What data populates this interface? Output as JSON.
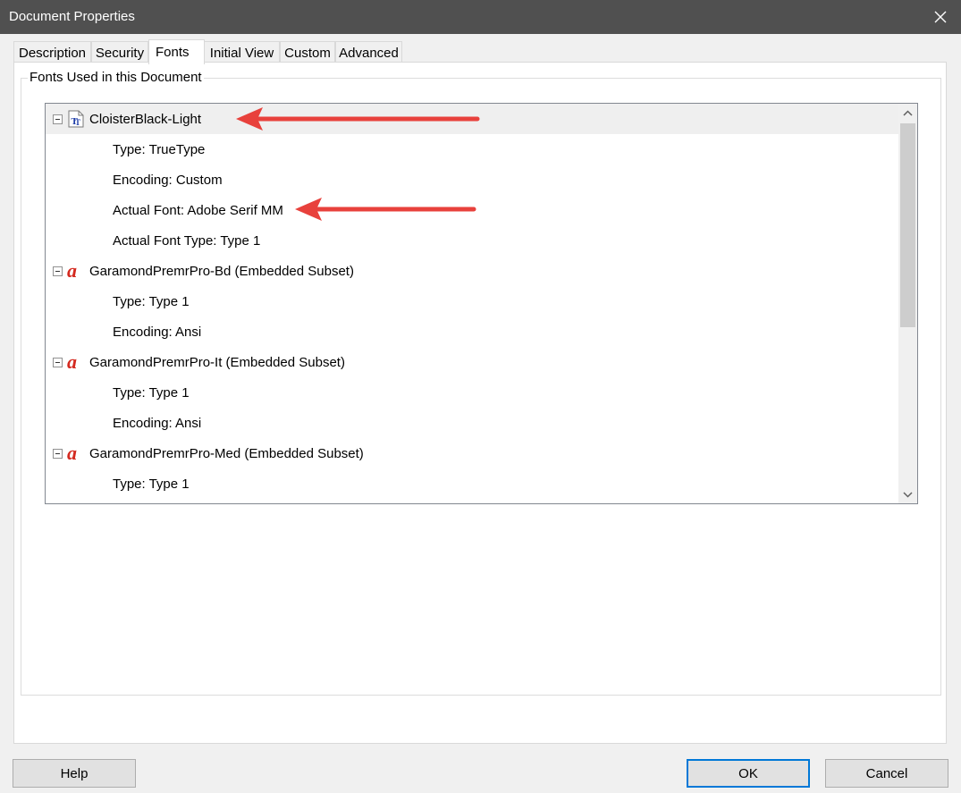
{
  "window": {
    "title": "Document Properties",
    "close_icon": "close-icon"
  },
  "tabs": [
    {
      "label": "Description"
    },
    {
      "label": "Security"
    },
    {
      "label": "Fonts",
      "active": true
    },
    {
      "label": "Initial View"
    },
    {
      "label": "Custom"
    },
    {
      "label": "Advanced"
    }
  ],
  "fonts_group": {
    "label": "Fonts Used in this Document",
    "fonts": [
      {
        "name": "CloisterBlack-Light",
        "icon": "truetype-font-icon",
        "properties": [
          "Type: TrueType",
          "Encoding: Custom",
          "Actual Font: Adobe Serif MM",
          "Actual Font Type: Type 1"
        ]
      },
      {
        "name": "GaramondPremrPro-Bd (Embedded Subset)",
        "icon": "opentype-font-icon",
        "properties": [
          "Type: Type 1",
          "Encoding: Ansi"
        ]
      },
      {
        "name": "GaramondPremrPro-It (Embedded Subset)",
        "icon": "opentype-font-icon",
        "properties": [
          "Type: Type 1",
          "Encoding: Ansi"
        ]
      },
      {
        "name": "GaramondPremrPro-Med (Embedded Subset)",
        "icon": "opentype-font-icon",
        "properties": [
          "Type: Type 1"
        ]
      }
    ]
  },
  "buttons": {
    "help": "Help",
    "ok": "OK",
    "cancel": "Cancel"
  },
  "colors": {
    "titlebar": "#505050",
    "annotation_arrow": "#e8413c",
    "accent": "#0078d7"
  }
}
